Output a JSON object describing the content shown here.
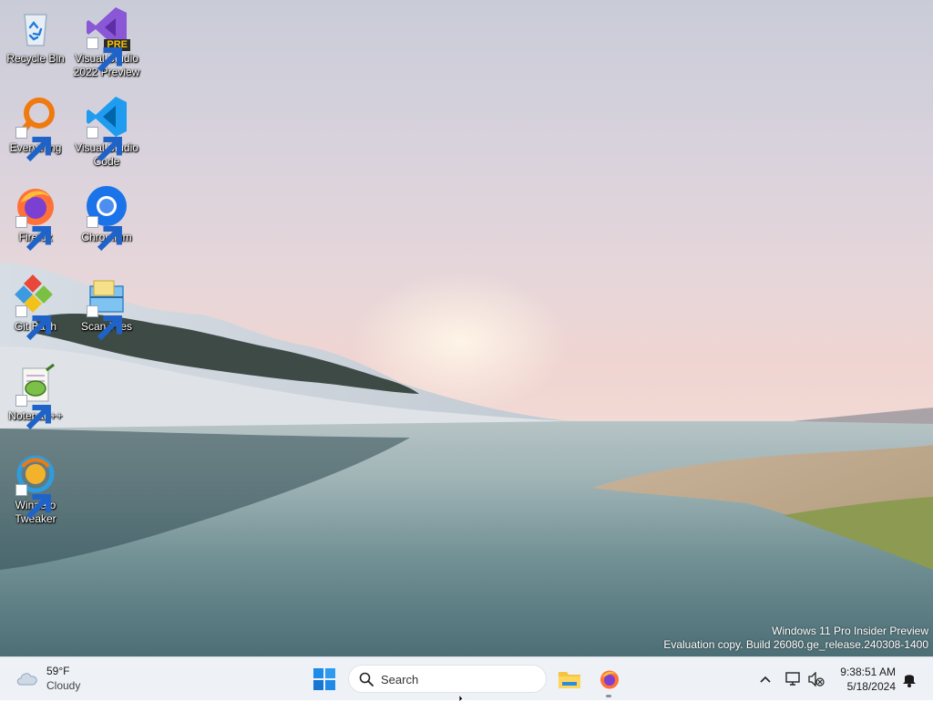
{
  "desktop": {
    "icons": [
      {
        "label": "Recycle Bin",
        "icon": "recycle-bin-icon"
      },
      {
        "label": "Visual Studio 2022 Preview",
        "icon": "visual-studio-icon",
        "badge": "PRE"
      },
      {
        "label": "Everything",
        "icon": "everything-search-icon"
      },
      {
        "label": "Visual Studio Code",
        "icon": "vscode-icon"
      },
      {
        "label": "Firefox",
        "icon": "firefox-icon"
      },
      {
        "label": "Chromium",
        "icon": "chromium-icon"
      },
      {
        "label": "Git Bash",
        "icon": "git-bash-icon"
      },
      {
        "label": "Scan Files",
        "icon": "scan-files-icon"
      },
      {
        "label": "Notepad++",
        "icon": "notepad-plus-plus-icon"
      },
      {
        "label": "Winaero Tweaker",
        "icon": "winaero-tweaker-icon"
      }
    ],
    "watermark": {
      "line1": "Windows 11 Pro Insider Preview",
      "line2": "Evaluation copy. Build 26080.ge_release.240308-1400"
    }
  },
  "taskbar": {
    "weather": {
      "temp": "59°F",
      "condition": "Cloudy",
      "icon": "cloud-icon"
    },
    "start_icon": "windows-start-icon",
    "search": {
      "placeholder": "Search",
      "icon": "search-icon"
    },
    "pinned": [
      {
        "name": "File Explorer",
        "icon": "file-explorer-icon"
      },
      {
        "name": "Firefox",
        "icon": "firefox-icon",
        "running": true
      }
    ],
    "tray": {
      "chevron_icon": "chevron-up-icon",
      "network_icon": "network-icon",
      "volume_icon": "volume-muted-icon",
      "notification_icon": "bell-icon"
    },
    "clock": {
      "time": "9:38:51 AM",
      "date": "5/18/2024"
    }
  },
  "colors": {
    "taskbar_bg": "#eef1f6",
    "accent": "#0067c0"
  }
}
